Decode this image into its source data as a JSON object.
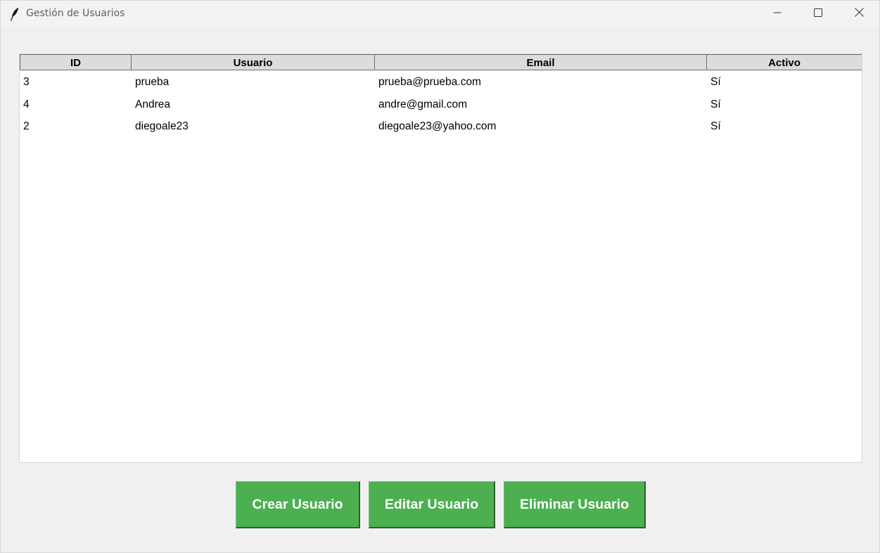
{
  "window": {
    "title": "Gestión de Usuarios",
    "controls": {
      "minimize_icon": "minimize-icon",
      "maximize_icon": "maximize-icon",
      "close_icon": "close-icon"
    }
  },
  "table": {
    "columns": [
      "ID",
      "Usuario",
      "Email",
      "Activo"
    ],
    "rows": [
      [
        "3",
        "prueba",
        "prueba@prueba.com",
        "Sí"
      ],
      [
        "4",
        "Andrea",
        "andre@gmail.com",
        "Sí"
      ],
      [
        "2",
        "diegoale23",
        "diegoale23@yahoo.com",
        "Sí"
      ]
    ]
  },
  "buttons": {
    "crear": "Crear Usuario",
    "editar": "Editar Usuario",
    "eliminar": "Eliminar Usuario"
  },
  "colors": {
    "button_green": "#4caf50",
    "header_bg": "#dcdcdc",
    "window_bg": "#f0f0f0"
  }
}
